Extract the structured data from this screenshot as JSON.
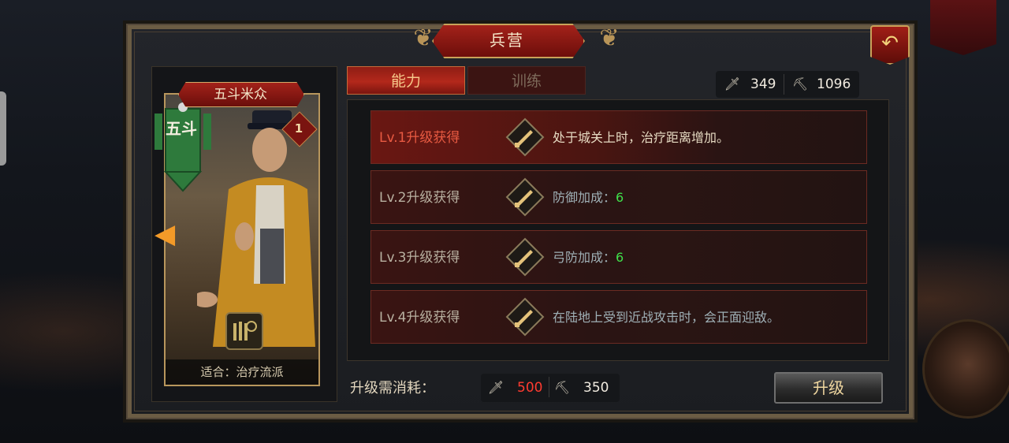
{
  "window": {
    "title": "兵营",
    "back_icon": "back-arrow-icon"
  },
  "unit_card": {
    "name": "五斗米众",
    "faction_text": "五斗",
    "level": "1",
    "suitable_for": "适合：治疗流派"
  },
  "tabs": [
    {
      "label": "能力",
      "active": true
    },
    {
      "label": "训练",
      "active": false
    }
  ],
  "resources": {
    "sword_icon": "sword-resource-icon",
    "sword_amount": "349",
    "ore_icon": "ore-resource-icon",
    "ore_amount": "1096"
  },
  "upgrades": [
    {
      "level": "Lv.1升级获得",
      "text": "处于城关上时，治疗距离增加。",
      "value": ""
    },
    {
      "level": "Lv.2升级获得",
      "text": "防御加成：",
      "value": "6"
    },
    {
      "level": "Lv.3升级获得",
      "text": "弓防加成：",
      "value": "6"
    },
    {
      "level": "Lv.4升级获得",
      "text": "在陆地上受到近战攻击时，会正面迎敌。",
      "value": ""
    }
  ],
  "cost": {
    "label": "升级需消耗：",
    "sword_amount": "500",
    "ore_amount": "350",
    "sword_color": "#ff3b30"
  },
  "upgrade_button": {
    "label": "升级"
  },
  "colors": {
    "accent_red": "#a3221a",
    "gold": "#c9a25a",
    "value_green": "#3fe04a"
  }
}
